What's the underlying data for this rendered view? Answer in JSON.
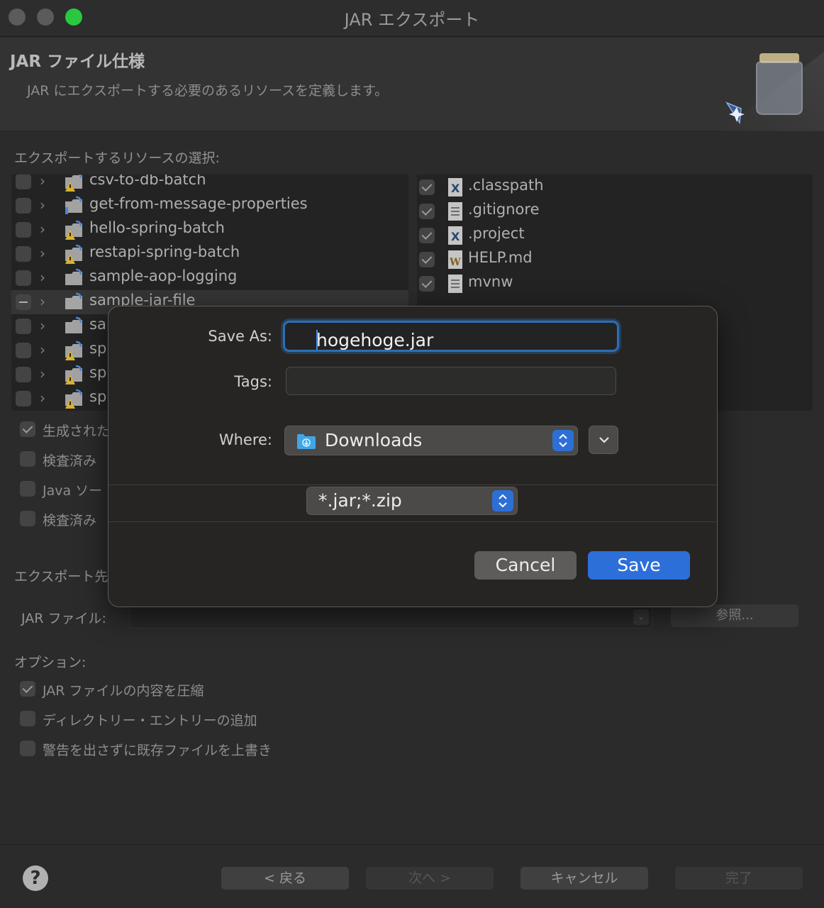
{
  "window": {
    "title": "JAR エクスポート"
  },
  "header": {
    "title": "JAR ファイル仕様",
    "description": "JAR にエクスポートする必要のあるリソースを定義します。"
  },
  "resources_label": "エクスポートするリソースの選択:",
  "left_tree": [
    {
      "label": "csv-to-db-batch",
      "state": "unchecked",
      "selected": false
    },
    {
      "label": "get-from-message-properties",
      "state": "unchecked",
      "selected": false
    },
    {
      "label": "hello-spring-batch",
      "state": "unchecked",
      "selected": false
    },
    {
      "label": "restapi-spring-batch",
      "state": "unchecked",
      "selected": false
    },
    {
      "label": "sample-aop-logging",
      "state": "unchecked",
      "selected": false
    },
    {
      "label": "sample-jar-file",
      "state": "mixed",
      "selected": true
    },
    {
      "label": "sa",
      "state": "unchecked",
      "selected": false
    },
    {
      "label": "sp",
      "state": "unchecked",
      "selected": false
    },
    {
      "label": "sp",
      "state": "unchecked",
      "selected": false
    },
    {
      "label": "sp",
      "state": "unchecked",
      "selected": false
    }
  ],
  "right_tree": [
    {
      "label": ".classpath",
      "icon": "xml-file-icon"
    },
    {
      "label": ".gitignore",
      "icon": "text-file-icon"
    },
    {
      "label": ".project",
      "icon": "xml-file-icon"
    },
    {
      "label": "HELP.md",
      "icon": "word-file-icon"
    },
    {
      "label": "mvnw",
      "icon": "text-file-icon"
    }
  ],
  "export_options": [
    {
      "label": "生成された",
      "checked": true
    },
    {
      "label": "検査済み",
      "checked": false
    },
    {
      "label": "Java ソー",
      "checked": false
    },
    {
      "label": "検査済み",
      "checked": false
    }
  ],
  "export_dest_label": "エクスポート先",
  "jar_file_label": "JAR ファイル:",
  "browse_label": "参照...",
  "options_label": "オプション:",
  "options": [
    {
      "label": "JAR ファイルの内容を圧縮",
      "checked": true
    },
    {
      "label": "ディレクトリー・エントリーの追加",
      "checked": false
    },
    {
      "label": "警告を出さずに既存ファイルを上書き",
      "checked": false
    }
  ],
  "footer": {
    "help": "?",
    "back": "< 戻る",
    "next": "次へ >",
    "cancel": "キャンセル",
    "finish": "完了"
  },
  "save_dialog": {
    "save_as_label": "Save As:",
    "save_as_value": "hogehoge.jar",
    "tags_label": "Tags:",
    "where_label": "Where:",
    "where_value": "Downloads",
    "filter_value": "*.jar;*.zip",
    "cancel_label": "Cancel",
    "save_label": "Save"
  },
  "colors": {
    "accent_blue": "#2d6fd8",
    "traffic_green": "#2ac840"
  }
}
